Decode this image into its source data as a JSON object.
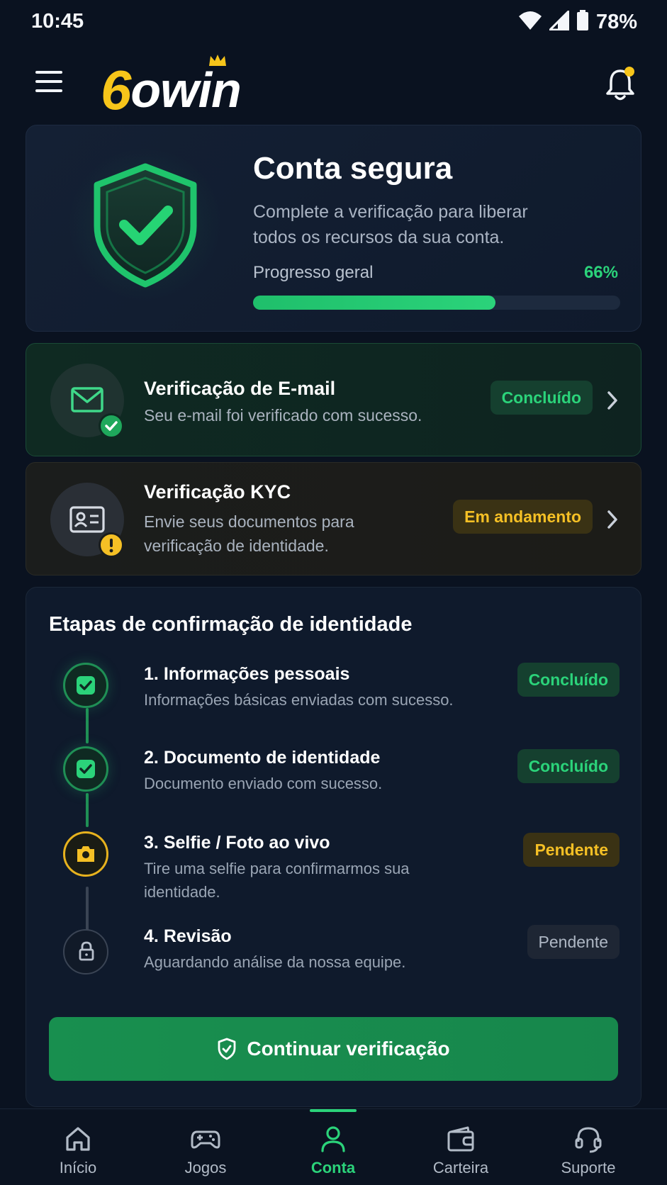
{
  "status_bar": {
    "time": "10:45",
    "battery": "78%"
  },
  "header": {
    "logo_number": "6",
    "logo_text": "owin"
  },
  "hero": {
    "title": "Conta segura",
    "description": "Complete a verificação para liberar todos os recursos da sua conta.",
    "progress_label": "Progresso geral",
    "progress_value": "66%",
    "progress_fraction": 0.66
  },
  "email_card": {
    "title": "Verificação de E-mail",
    "description": "Seu e-mail foi verificado com sucesso.",
    "status": "Concluído"
  },
  "kyc_card": {
    "title": "Verificação KYC",
    "description": "Envie seus documentos para verificação de identidade.",
    "status": "Em andamento"
  },
  "steps": {
    "title": "Etapas de confirmação de identidade",
    "items": [
      {
        "number": "1.",
        "title": "Informações pessoais",
        "description": "Informações básicas enviadas com sucesso.",
        "status": "Concluído"
      },
      {
        "number": "2.",
        "title": "Documento de identidade",
        "description": "Documento enviado com sucesso.",
        "status": "Concluído"
      },
      {
        "number": "3.",
        "title": "Selfie / Foto ao vivo",
        "description": "Tire uma selfie para confirmarmos sua identidade.",
        "status": "Pendente"
      },
      {
        "number": "4.",
        "title": "Revisão",
        "description": "Aguardando análise da nossa equipe.",
        "status": "Pendente"
      }
    ],
    "continue_label": "Continuar verificação"
  },
  "bottom_nav": {
    "items": [
      {
        "label": "Início",
        "icon": "home-icon"
      },
      {
        "label": "Jogos",
        "icon": "gamepad-icon"
      },
      {
        "label": "Conta",
        "icon": "user-icon"
      },
      {
        "label": "Carteira",
        "icon": "wallet-icon"
      },
      {
        "label": "Suporte",
        "icon": "headset-icon"
      }
    ],
    "active": "Conta"
  },
  "colors": {
    "background": "#0a1220",
    "accent_green": "#2bd37a",
    "accent_yellow": "#f5c025",
    "button_green": "#188f4f",
    "logo_yellow": "#f7c51a"
  }
}
